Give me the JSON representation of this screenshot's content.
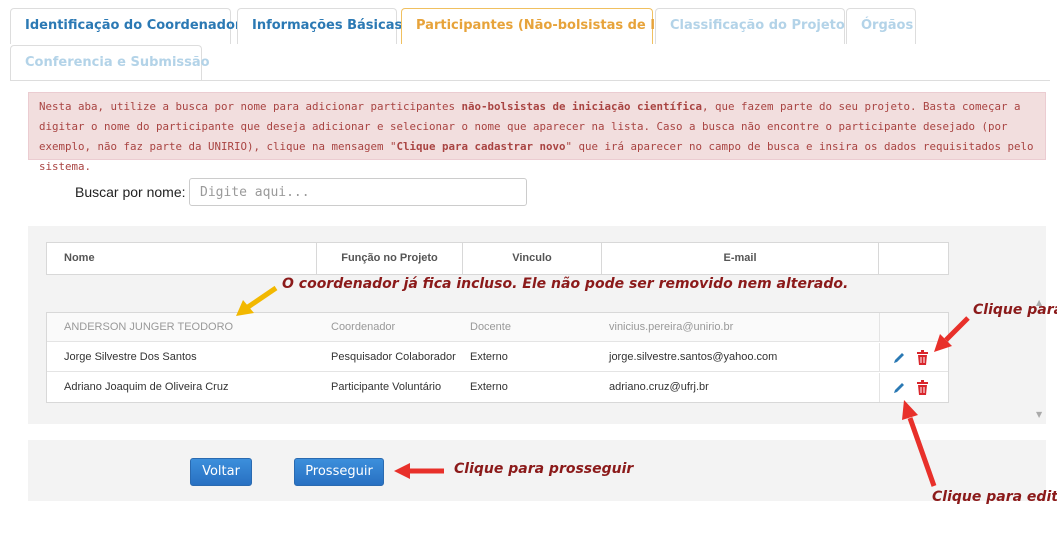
{
  "tabs": [
    {
      "label": "Identificação do Coordenador",
      "state": "enabled"
    },
    {
      "label": "Informações Básicas",
      "state": "enabled"
    },
    {
      "label": "Participantes (Não-bolsistas de IC)",
      "state": "active"
    },
    {
      "label": "Classificação do Projeto",
      "state": "disabled"
    },
    {
      "label": "Órgãos",
      "state": "disabled"
    },
    {
      "label": "Conferencia e Submissão",
      "state": "disabled"
    }
  ],
  "alert": {
    "p1": "Nesta aba, utilize a busca por nome para adicionar participantes ",
    "b1": "não-bolsistas de iniciação científica",
    "p2": ", que fazem parte do seu projeto. Basta começar a digitar o nome do participante que deseja adicionar e selecionar o nome que aparecer na lista. Caso a busca não encontre o participante desejado (por exemplo, não faz parte da UNIRIO), clique na mensagem \"",
    "b2": "Clique para cadastrar novo",
    "p3": "\" que irá aparecer no campo de busca e insira os dados requisitados pelo sistema."
  },
  "search": {
    "label": "Buscar por nome:",
    "placeholder": "Digite aqui..."
  },
  "table": {
    "headers": [
      "Nome",
      "Função no Projeto",
      "Vinculo",
      "E-mail"
    ],
    "rows": [
      {
        "nome": "ANDERSON JUNGER TEODORO",
        "funcao": "Coordenador",
        "vinculo": "Docente",
        "email": "vinicius.pereira@unirio.br"
      },
      {
        "nome": "Jorge Silvestre Dos Santos",
        "funcao": "Pesquisador Colaborador",
        "vinculo": "Externo",
        "email": "jorge.silvestre.santos@yahoo.com"
      },
      {
        "nome": "Adriano Joaquim de Oliveira Cruz",
        "funcao": "Participante Voluntário",
        "vinculo": "Externo",
        "email": "adriano.cruz@ufrj.br"
      }
    ]
  },
  "buttons": {
    "back": "Voltar",
    "next": "Prosseguir"
  },
  "annotations": {
    "coordinator": "O coordenador já fica incluso. Ele não pode ser removido nem alterado.",
    "remove": "Clique para",
    "proceed": "Clique para prosseguir",
    "edit": "Clique para edita"
  },
  "colors": {
    "active_tab": "#e7a33a",
    "tab": "#2b79b4",
    "alert_bg": "#f2dede",
    "alert_text": "#a94442",
    "button": "#2f7bcf",
    "edit_icon": "#2b79b4",
    "delete_icon": "#d9262c",
    "annotation_arrow": "#e8302a",
    "coordinator_arrow": "#f2b800"
  }
}
